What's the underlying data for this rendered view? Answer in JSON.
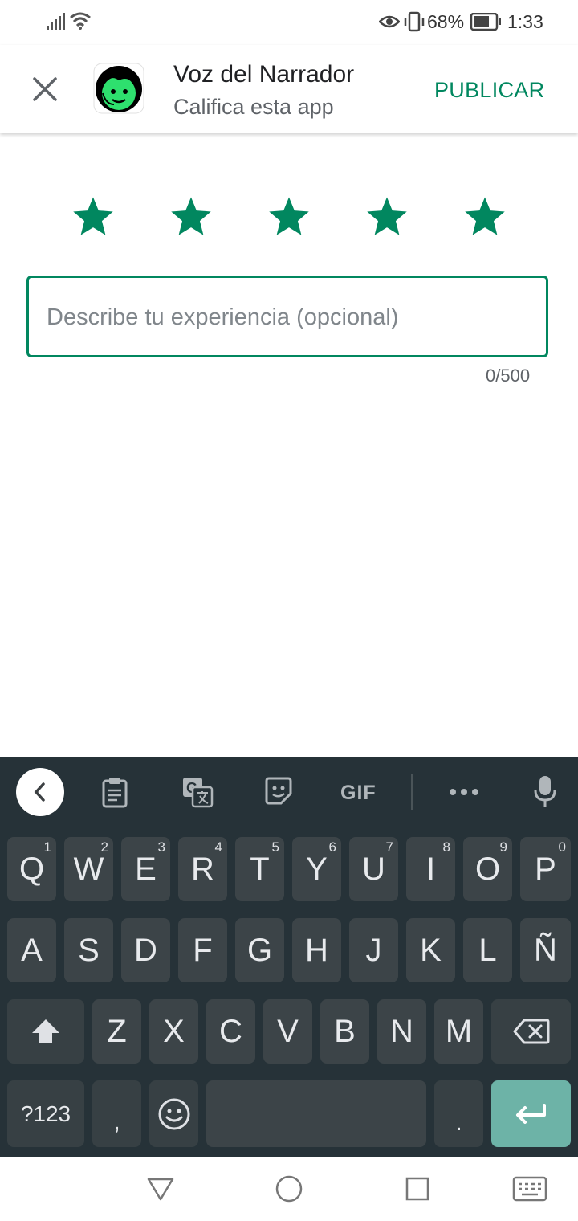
{
  "status_bar": {
    "battery": "68%",
    "time": "1:33"
  },
  "header": {
    "close_icon": "close-icon",
    "app_name": "Voz del Narrador",
    "subtitle": "Califica esta app",
    "publish_label": "PUBLICAR"
  },
  "rating": {
    "stars_selected": 5,
    "stars_total": 5,
    "color": "#01875f"
  },
  "review": {
    "placeholder": "Describe tu experiencia (opcional)",
    "value": "",
    "counter": "0/500"
  },
  "keyboard": {
    "toolbar": [
      "back-icon",
      "clipboard-icon",
      "translate-icon",
      "sticker-icon",
      "GIF",
      "more-icon",
      "mic-icon"
    ],
    "gif_label": "GIF",
    "row1": [
      {
        "k": "Q",
        "h": "1"
      },
      {
        "k": "W",
        "h": "2"
      },
      {
        "k": "E",
        "h": "3"
      },
      {
        "k": "R",
        "h": "4"
      },
      {
        "k": "T",
        "h": "5"
      },
      {
        "k": "Y",
        "h": "6"
      },
      {
        "k": "U",
        "h": "7"
      },
      {
        "k": "I",
        "h": "8"
      },
      {
        "k": "O",
        "h": "9"
      },
      {
        "k": "P",
        "h": "0"
      }
    ],
    "row2": [
      "A",
      "S",
      "D",
      "F",
      "G",
      "H",
      "J",
      "K",
      "L",
      "Ñ"
    ],
    "row3": [
      "Z",
      "X",
      "C",
      "V",
      "B",
      "N",
      "M"
    ],
    "symbols_label": "?123",
    "comma_label": ",",
    "period_label": "."
  },
  "colors": {
    "accent": "#01875f",
    "keyboard_bg": "#263238",
    "key_bg": "#3c4448",
    "enter_key": "#6db3a7"
  }
}
